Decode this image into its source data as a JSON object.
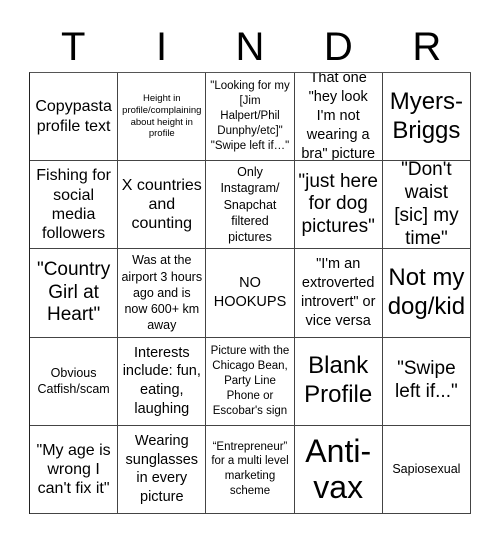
{
  "header": {
    "letters": [
      "T",
      "I",
      "N",
      "D",
      "R"
    ]
  },
  "grid": {
    "rows": [
      [
        "Copypasta profile text",
        "Height in profile/complaining about height in profile",
        "\"Looking for my [Jim Halpert/Phil Dunphy/etc]\" \"Swipe left if…\"",
        "That one \"hey look I'm not wearing a bra\" picture",
        "Myers-Briggs"
      ],
      [
        "Fishing for social media followers",
        "X countries and counting",
        "Only Instagram/ Snapchat filtered pictures",
        "\"just here for dog pictures\"",
        "\"Don't waist [sic] my time\""
      ],
      [
        "\"Country Girl at Heart\"",
        "Was at the airport 3 hours ago and is now 600+ km away",
        "NO HOOKUPS",
        "\"I'm an extroverted introvert\" or vice versa",
        "Not my dog/kid"
      ],
      [
        "Obvious Catfish/scam",
        "Interests include: fun, eating, laughing",
        "Picture with the Chicago Bean, Party Line Phone or Escobar's sign",
        "Blank Profile",
        "\"Swipe left if...\""
      ],
      [
        "\"My age is wrong I can't fix it\"",
        "Wearing sunglasses in every picture",
        "“Entrepreneur” for a multi level marketing scheme",
        "Anti-vax",
        "Sapiosexual"
      ]
    ]
  }
}
